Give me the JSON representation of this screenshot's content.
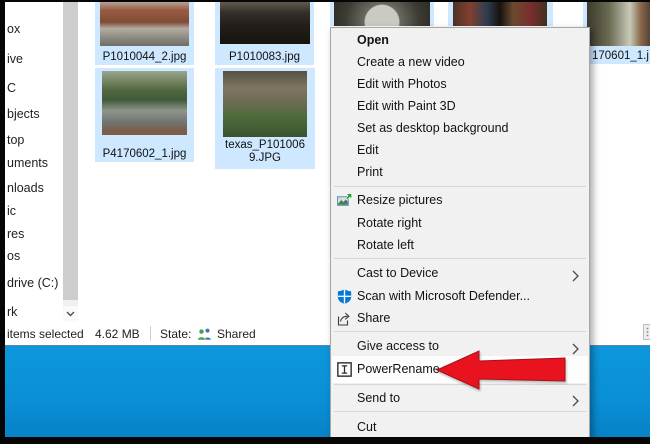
{
  "colors": {
    "desktop_blue": "#0a8fd6",
    "selection_blue": "#cde8ff",
    "annotation_arrow_red": "#e8131e",
    "defender_icon_blue": "#0078d7",
    "menu_background": "#f1f1f1"
  },
  "window": {
    "sidebar": {
      "items": [
        {
          "label": "ox"
        },
        {
          "label": "ive"
        },
        {
          "label": "C"
        },
        {
          "label": "bjects"
        },
        {
          "label": "top"
        },
        {
          "label": "uments"
        },
        {
          "label": "nloads"
        },
        {
          "label": "ic"
        },
        {
          "label": "res"
        },
        {
          "label": "os"
        },
        {
          "label": "drive (C:)"
        },
        {
          "label": "rk"
        }
      ]
    },
    "files": {
      "tiles": [
        {
          "name": "P1010044_2.jpg"
        },
        {
          "name": "P1010083.jpg"
        },
        {
          "name": ""
        },
        {
          "name": ""
        },
        {
          "name": "170601_1.j"
        },
        {
          "name": "P4170602_1.jpg"
        },
        {
          "name": "texas_P1010069.JPG"
        }
      ]
    },
    "statusbar": {
      "selection": "items selected",
      "size": "4.62 MB",
      "state_label": "State:",
      "state_value": "Shared"
    }
  },
  "context_menu": {
    "items": [
      {
        "label": "Open"
      },
      {
        "label": "Create a new video"
      },
      {
        "label": "Edit with Photos"
      },
      {
        "label": "Edit with Paint 3D"
      },
      {
        "label": "Set as desktop background"
      },
      {
        "label": "Edit"
      },
      {
        "label": "Print"
      },
      {
        "label": "Resize pictures"
      },
      {
        "label": "Rotate right"
      },
      {
        "label": "Rotate left"
      },
      {
        "label": "Cast to Device"
      },
      {
        "label": "Scan with Microsoft Defender..."
      },
      {
        "label": "Share"
      },
      {
        "label": "Give access to"
      },
      {
        "label": "PowerRename"
      },
      {
        "label": "Send to"
      },
      {
        "label": "Cut"
      }
    ]
  }
}
